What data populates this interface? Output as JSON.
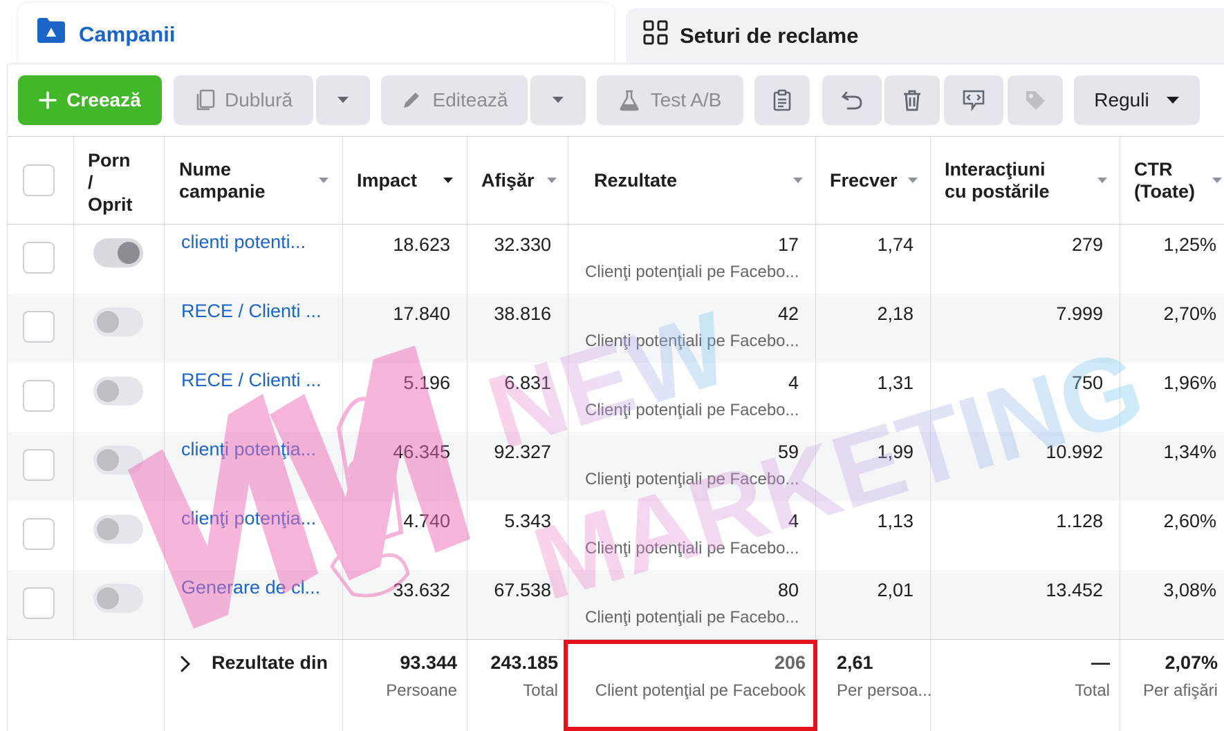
{
  "tabs": {
    "campaigns": "Campanii",
    "adsets": "Seturi de reclame"
  },
  "toolbar": {
    "create": "Creează",
    "duplicate": "Dublură",
    "edit": "Editează",
    "ab_test": "Test A/B",
    "rules": "Reguli"
  },
  "columns": {
    "onoff": [
      "Porn",
      "/",
      "Oprit"
    ],
    "name": [
      "Nume",
      "campanie"
    ],
    "impact": "Impact",
    "impressions": "Afişăr",
    "results": "Rezultate",
    "frequency": "Frecver",
    "engagement": [
      "Interacţiuni",
      "cu postările"
    ],
    "ctr": [
      "CTR",
      "(Toate)"
    ]
  },
  "rows": [
    {
      "name": "clienti potenti...",
      "on": true,
      "impact": "18.623",
      "impressions": "32.330",
      "results": "17",
      "results_type": "Clienţi potenţiali pe Facebo...",
      "frequency": "1,74",
      "engagement": "279",
      "ctr": "1,25%"
    },
    {
      "name": "RECE / Clienti ...",
      "on": false,
      "impact": "17.840",
      "impressions": "38.816",
      "results": "42",
      "results_type": "Clienţi potenţiali pe Facebo...",
      "frequency": "2,18",
      "engagement": "7.999",
      "ctr": "2,70%"
    },
    {
      "name": "RECE / Clienti ...",
      "on": false,
      "impact": "5.196",
      "impressions": "6.831",
      "results": "4",
      "results_type": "Clienţi potenţiali pe Facebo...",
      "frequency": "1,31",
      "engagement": "750",
      "ctr": "1,96%"
    },
    {
      "name": "clienţi potenţia...",
      "on": false,
      "impact": "46.345",
      "impressions": "92.327",
      "results": "59",
      "results_type": "Clienţi potenţiali pe Facebo...",
      "frequency": "1,99",
      "engagement": "10.992",
      "ctr": "1,34%"
    },
    {
      "name": "clienţi potenţia...",
      "on": false,
      "impact": "4.740",
      "impressions": "5.343",
      "results": "4",
      "results_type": "Clienţi potenţiali pe Facebo...",
      "frequency": "1,13",
      "engagement": "1.128",
      "ctr": "2,60%"
    },
    {
      "name": "Generare de cl...",
      "on": false,
      "impact": "33.632",
      "impressions": "67.538",
      "results": "80",
      "results_type": "Clienţi potenţiali pe Facebo...",
      "frequency": "2,01",
      "engagement": "13.452",
      "ctr": "3,08%"
    }
  ],
  "totals": {
    "label": "Rezultate din",
    "impact": "93.344",
    "impact_sub": "Persoane",
    "impressions": "243.185",
    "impressions_sub": "Total",
    "results": "206",
    "results_sub": "Client potenţial pe Facebook",
    "frequency": "2,61",
    "frequency_sub": "Per persoa...",
    "engagement": "—",
    "engagement_sub": "Total",
    "ctr": "2,07%",
    "ctr_sub": "Per afişări"
  },
  "watermark": {
    "line1": "NEW",
    "line2": "MARKETING"
  },
  "colors": {
    "accent": "#1a66c8",
    "create": "#42b72a",
    "highlight": "#e4121a"
  }
}
